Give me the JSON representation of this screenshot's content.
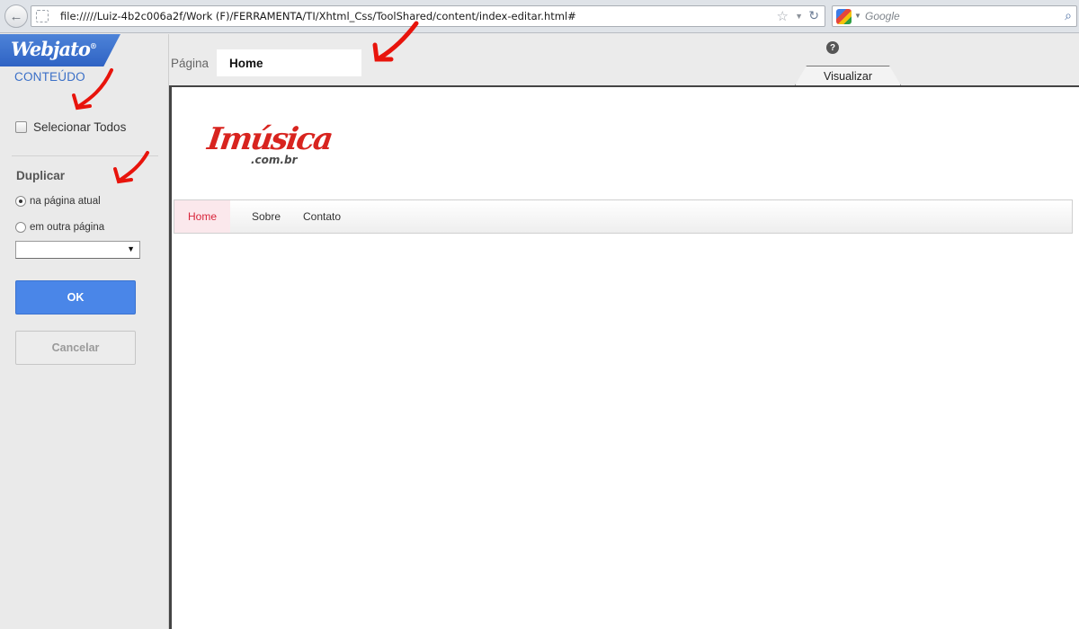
{
  "browser": {
    "url": "file://///Luiz-4b2c006a2f/Work  (F)/FERRAMENTA/TI/Xhtml_Css/ToolShared/content/index-editar.html#",
    "search_placeholder": "Google",
    "back_glyph": "←",
    "star_glyph": "☆",
    "reload_glyph": "↻",
    "search_glyph": "⌕"
  },
  "sidebar": {
    "logo": "Webjato",
    "logo_mark": "®",
    "section_title": "CONTEÚDO",
    "select_all_label": "Selecionar Todos",
    "duplicate_heading": "Duplicar",
    "options": [
      {
        "label": "na página atual",
        "selected": true
      },
      {
        "label": "em outra página",
        "selected": false
      }
    ],
    "page_select_value": "",
    "ok_label": "OK",
    "cancel_label": "Cancelar"
  },
  "toolbar": {
    "page_label": "Página",
    "page_name": "Home",
    "help_glyph": "?",
    "preview_tab_label": "Visualizar"
  },
  "preview": {
    "site_logo_main": "Imúsica",
    "site_logo_sub": ".com.br",
    "nav": [
      "Home",
      "Sobre",
      "Contato"
    ],
    "active_nav": "Home"
  },
  "colors": {
    "accent_blue": "#4a86e8",
    "brand_red": "#d8241f",
    "annotation_red": "#e8140c"
  }
}
